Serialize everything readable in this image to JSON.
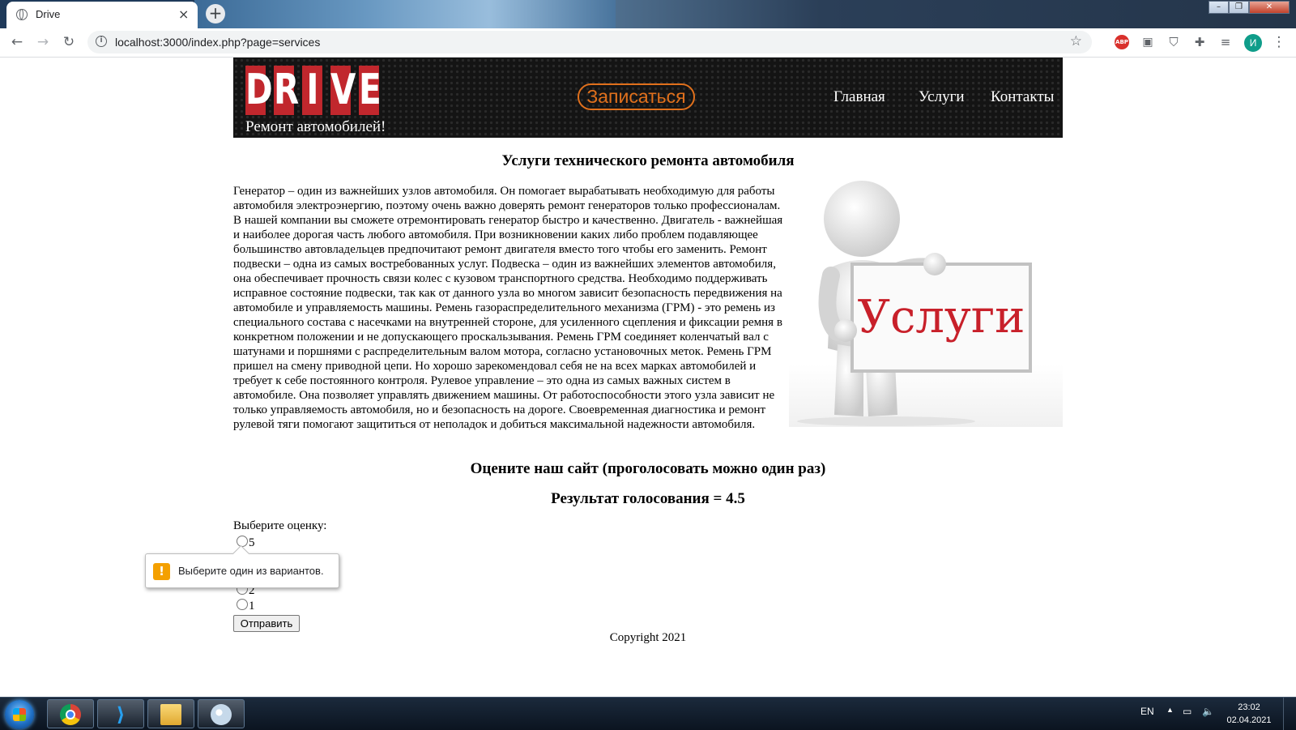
{
  "browser": {
    "tab_title": "Drive",
    "tab_close": "×",
    "new_tab": "+",
    "url": "localhost:3000/index.php?page=services",
    "abp_label": "ABP",
    "profile_initial": "И"
  },
  "header": {
    "logo_letters": [
      "D",
      "R",
      "I",
      "V",
      "E"
    ],
    "tagline": "Ремонт автомобилей!",
    "signup_label": "Записаться",
    "nav": [
      "Главная",
      "Услуги",
      "Контакты"
    ]
  },
  "content": {
    "heading": "Услуги технического ремонта автомобиля",
    "image_caption": "Услуги",
    "body": "Генератор – один из важнейших узлов автомобиля. Он помогает вырабатывать необходимую для работы автомобиля электроэнергию, поэтому очень важно доверять ремонт генераторов только профессионалам. В нашей компании вы сможете отремонтировать генератор быстро и качественно. Двигатель - важнейшая и наиболее дорогая часть любого автомобиля. При возникновении каких либо проблем подавляющее большинство автовладельцев предпочитают ремонт двигателя вместо того чтобы его заменить. Ремонт подвески – одна из самых востребованных услуг. Подвеска – один из важнейших элементов автомобиля, она обеспечивает прочность связи колес с кузовом транспортного средства. Необходимо поддерживать исправное состояние подвески, так как от данного узла во многом зависит безопасность передвижения на автомобиле и управляемость машины. Ремень газораспределительного механизма (ГРМ) - это ремень из специального состава с насечками на внутренней стороне, для усиленного сцепления и фиксации ремня в конкретном положении и не допускающего проскальзывания. Ремень ГРМ соединяет коленчатый вал с шатунами и поршнями с распределительным валом мотора, согласно установочных меток. Ремень ГРМ пришел на смену приводной цепи. Но хорошо зарекомендовал себя не на всех марках автомобилей и требует к себе постоянного контроля. Рулевое управление – это одна из самых важных систем в автомобиле. Она позволяет управлять движением машины. От работоспособности этого узла зависит не только управляемость автомобиля, но и безопасность на дороге. Своевременная диагностика и ремонт рулевой тяги помогают защититься от неполадок и добиться максимальной надежности автомобиля."
  },
  "vote": {
    "heading": "Оцените наш сайт (проголосовать можно один раз)",
    "result": "Результат голосования = 4.5",
    "prompt": "Выберите оценку:",
    "options_visible": [
      "5",
      "2",
      "1"
    ],
    "submit_label": "Отправить",
    "tooltip": "Выберите один из вариантов."
  },
  "footer": {
    "copyright": "Copyright 2021"
  },
  "taskbar": {
    "lang": "EN",
    "time": "23:02",
    "date": "02.04.2021"
  },
  "colors": {
    "logo_red": "#c1272d",
    "signup_orange": "#e0701c",
    "header_bg": "#141414",
    "image_text_red": "#c8202a"
  }
}
